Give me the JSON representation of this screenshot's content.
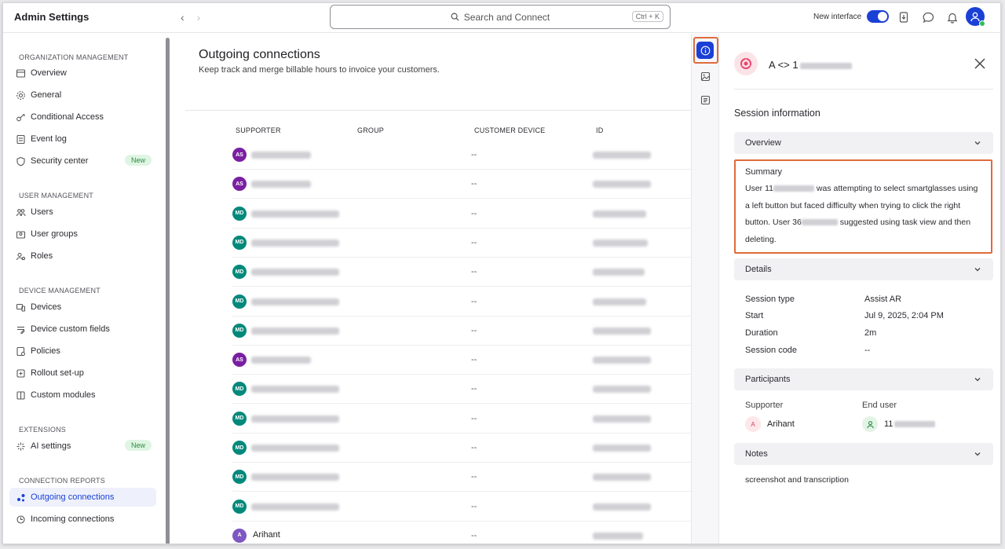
{
  "header": {
    "app_title": "Admin Settings",
    "search_placeholder": "Search and Connect",
    "search_shortcut": "Ctrl + K",
    "new_interface_label": "New interface",
    "new_interface_on": true
  },
  "sidebar": {
    "sections": [
      {
        "title": "ORGANIZATION MANAGEMENT",
        "items": [
          {
            "label": "Overview",
            "icon": "overview-icon"
          },
          {
            "label": "General",
            "icon": "gear-icon"
          },
          {
            "label": "Conditional Access",
            "icon": "conditional-access-icon"
          },
          {
            "label": "Event log",
            "icon": "event-log-icon"
          },
          {
            "label": "Security center",
            "icon": "shield-icon",
            "badge": "New"
          }
        ]
      },
      {
        "title": "USER MANAGEMENT",
        "items": [
          {
            "label": "Users",
            "icon": "users-icon"
          },
          {
            "label": "User groups",
            "icon": "user-groups-icon"
          },
          {
            "label": "Roles",
            "icon": "roles-icon"
          }
        ]
      },
      {
        "title": "DEVICE MANAGEMENT",
        "items": [
          {
            "label": "Devices",
            "icon": "devices-icon"
          },
          {
            "label": "Device custom fields",
            "icon": "custom-fields-icon"
          },
          {
            "label": "Policies",
            "icon": "policies-icon"
          },
          {
            "label": "Rollout set-up",
            "icon": "rollout-icon"
          },
          {
            "label": "Custom modules",
            "icon": "modules-icon"
          }
        ]
      },
      {
        "title": "EXTENSIONS",
        "items": [
          {
            "label": "AI settings",
            "icon": "sparkle-icon",
            "badge": "New"
          }
        ]
      },
      {
        "title": "CONNECTION REPORTS",
        "items": [
          {
            "label": "Outgoing connections",
            "icon": "outgoing-icon",
            "active": true
          },
          {
            "label": "Incoming connections",
            "icon": "incoming-icon"
          }
        ]
      }
    ]
  },
  "main": {
    "title": "Outgoing connections",
    "subtitle": "Keep track and merge billable hours to invoice your customers.",
    "columns": [
      "SUPPORTER",
      "GROUP",
      "CUSTOMER DEVICE",
      "ID"
    ],
    "rows": [
      {
        "initials": "AS",
        "color": "#7b1fa2",
        "device": "--"
      },
      {
        "initials": "AS",
        "color": "#7b1fa2",
        "device": "--"
      },
      {
        "initials": "MD",
        "color": "#00897b",
        "device": "--"
      },
      {
        "initials": "MD",
        "color": "#00897b",
        "device": "--"
      },
      {
        "initials": "MD",
        "color": "#00897b",
        "device": "--"
      },
      {
        "initials": "MD",
        "color": "#00897b",
        "device": "--"
      },
      {
        "initials": "MD",
        "color": "#00897b",
        "device": "--"
      },
      {
        "initials": "AS",
        "color": "#7b1fa2",
        "device": "--"
      },
      {
        "initials": "MD",
        "color": "#00897b",
        "device": "--"
      },
      {
        "initials": "MD",
        "color": "#00897b",
        "device": "--"
      },
      {
        "initials": "MD",
        "color": "#00897b",
        "device": "--"
      },
      {
        "initials": "MD",
        "color": "#00897b",
        "device": "--"
      },
      {
        "initials": "MD",
        "color": "#00897b",
        "device": "--"
      },
      {
        "initials": "A",
        "color": "#7e57c2",
        "name": "Arihant",
        "device": "--"
      }
    ]
  },
  "detail": {
    "title_prefix": "A <> 1",
    "session_info_title": "Session information",
    "overview_label": "Overview",
    "summary_heading": "Summary",
    "summary_parts": {
      "p1": "User 11",
      "p2": " was attempting to select smartglasses using a left button but faced difficulty when trying to click the right button. User 36",
      "p3": " suggested using task view and then deleting."
    },
    "details_label": "Details",
    "details": [
      {
        "k": "Session type",
        "v": "Assist AR"
      },
      {
        "k": "Start",
        "v": "Jul 9, 2025, 2:04 PM"
      },
      {
        "k": "Duration",
        "v": "2m"
      },
      {
        "k": "Session code",
        "v": "--"
      }
    ],
    "participants_label": "Participants",
    "supporter_label": "Supporter",
    "end_user_label": "End user",
    "supporter_initial": "A",
    "supporter_name": "Arihant",
    "end_user_prefix": "11",
    "notes_label": "Notes",
    "notes_text": "screenshot and transcription"
  },
  "colors": {
    "accent": "#1b40d6",
    "highlight": "#e06b3c"
  }
}
